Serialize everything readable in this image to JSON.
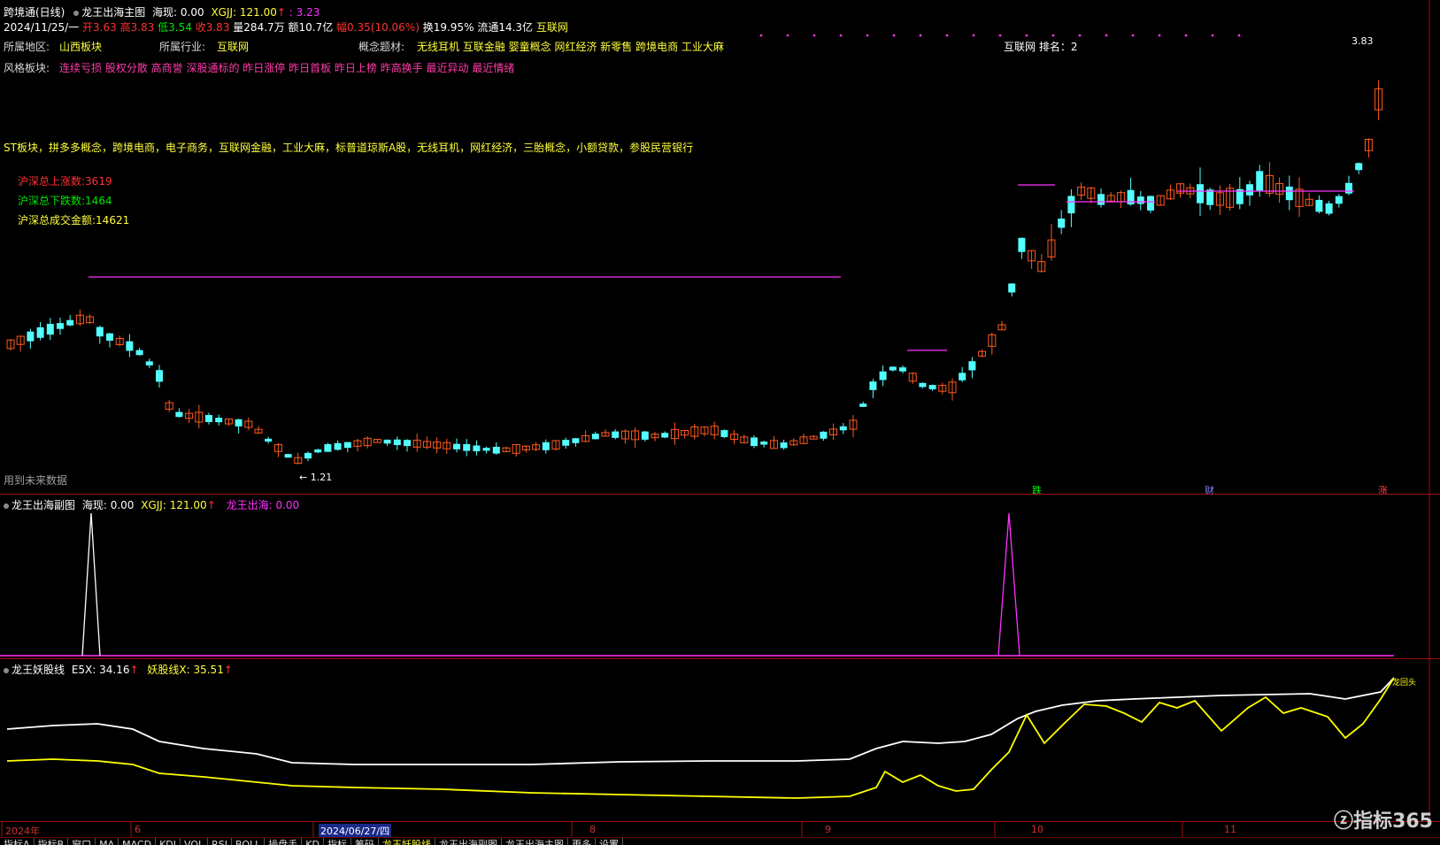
{
  "header": {
    "title": "跨境通(日线)",
    "main_indicator": "龙王出海主图",
    "haixian_label": "海现: 0.00",
    "xgjj_label": "XGJJ: 121.00",
    "xgjj_val": ": 3.23",
    "date": "2024/11/25/一",
    "open": "开3.63",
    "high": "高3.83",
    "low": "低3.54",
    "close": "收3.83",
    "volume": "量284.7万",
    "amount": "额10.7亿",
    "change": "幅0.35(10.06%)",
    "turnover": "换19.95%",
    "float": "流通14.3亿",
    "industry_tag": "互联网"
  },
  "info": {
    "region_label": "所属地区:",
    "region_value": "山西板块",
    "industry_label": "所属行业:",
    "industry_value": "互联网",
    "concept_label": "概念题材:",
    "concept_value": "无线耳机 互联金融 婴童概念 网红经济 新零售 跨境电商 工业大麻",
    "rank_label": "互联网 排名：2",
    "style_label": "风格板块:",
    "style_value": "连续亏损 股权分散 高商誉 深股通标的 昨日涨停 昨日首板 昨日上榜 昨高换手 最近异动 最近情绪",
    "st_line": "ST板块，拼多多概念，跨境电商，电子商务，互联网金融，工业大麻，标普道琼斯A股，无线耳机，网红经济，三胎概念，小额贷款，参股民营银行",
    "up_count": "沪深总上涨数:3619",
    "down_count": "沪深总下跌数:1464",
    "total_amount": "沪深总成交金额:14621",
    "future_data": "用到未来数据",
    "high_mark": "3.83",
    "low_mark": "1.21"
  },
  "markers": {
    "die": "跌",
    "cai": "财",
    "zhang": "涨"
  },
  "sub1": {
    "title": "龙王出海副图",
    "haixian": "海现: 0.00",
    "xgjj": "XGJJ: 121.00",
    "longwang": "龙王出海: 0.00"
  },
  "sub2": {
    "title": "龙王妖股线",
    "e5x": "E5X: 34.16",
    "yao": "妖股线X: 35.51",
    "end_label": "龙回头"
  },
  "xaxis": {
    "labels": [
      "2024年",
      "6",
      "2024/06/27/四",
      "8",
      "9",
      "10",
      "11"
    ]
  },
  "tabs": [
    "指标A",
    "指标B",
    "窗口",
    "MA",
    "MACD",
    "KDJ",
    "VOL",
    "RSI",
    "BOLL",
    "操盘手",
    "KD",
    "指标",
    "筹码",
    "龙王妖股线",
    "龙王出海副图",
    "龙王出海主图",
    "更多",
    "设置"
  ],
  "watermark": "指标365",
  "colors": {
    "up": "#ff5a1e",
    "down": "#54ffff",
    "bull_big": "#00c800",
    "line_white": "#ffffff",
    "line_yellow": "#ffff00",
    "magenta": "#ff32ff"
  }
}
